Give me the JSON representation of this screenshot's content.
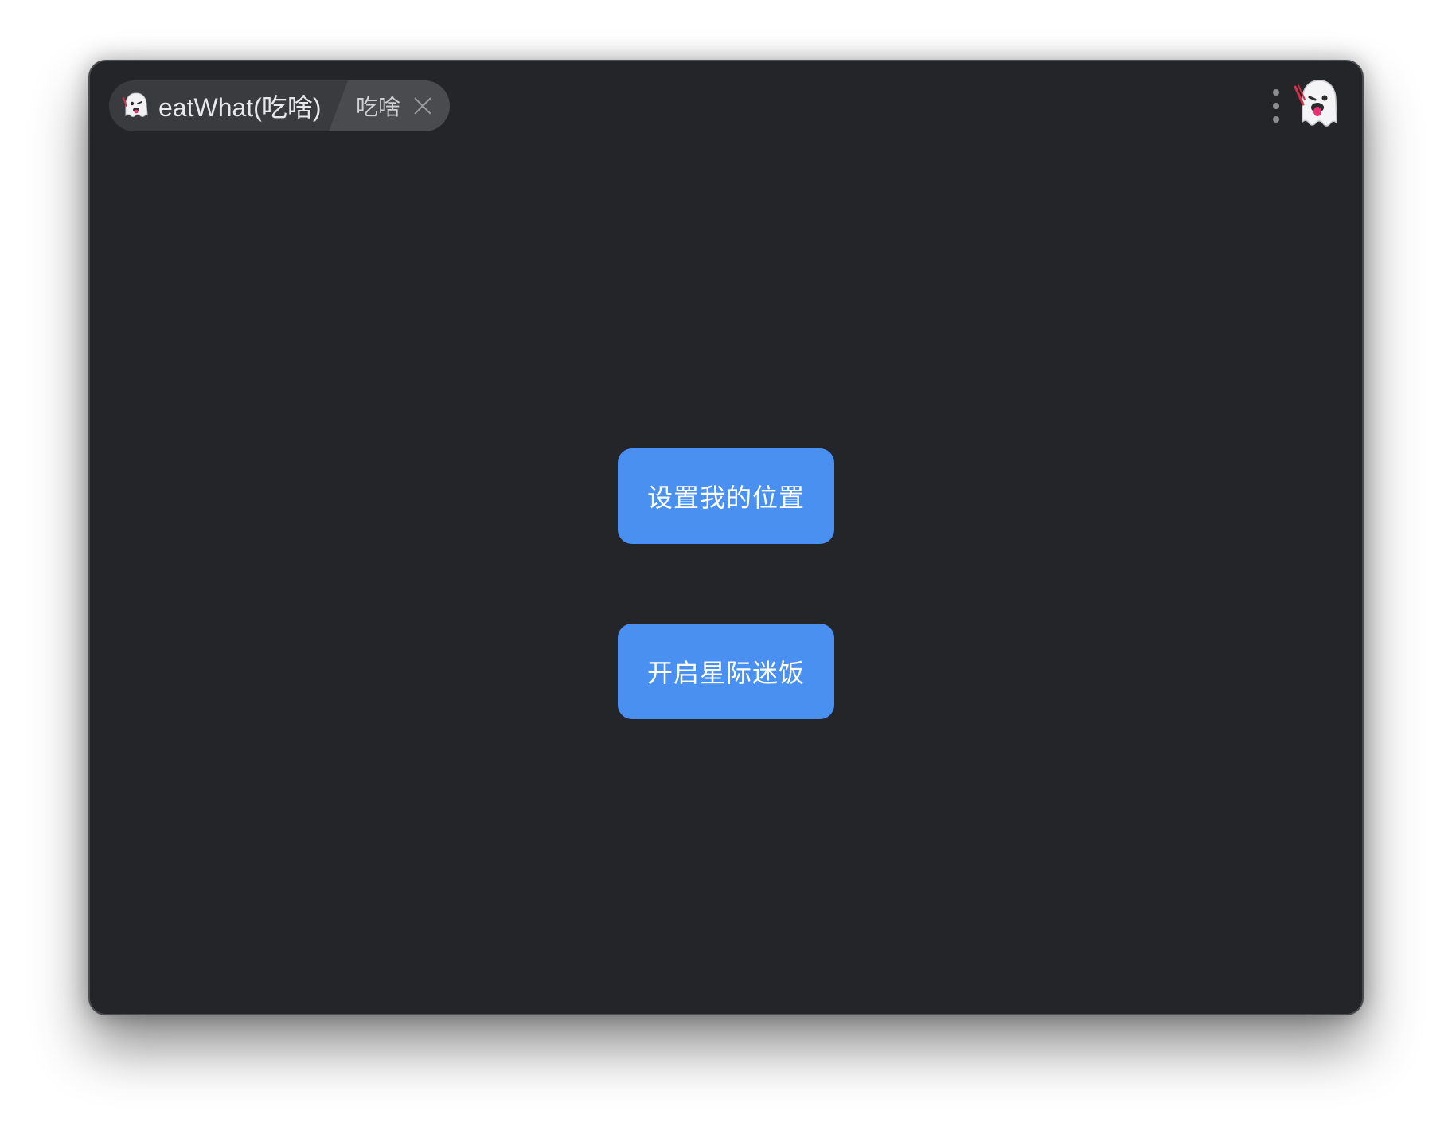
{
  "window": {
    "app_title": "eatWhat(吃啥)",
    "tab_label": "吃啥",
    "app_icon": "ghost-icon",
    "menu_icon": "vertical-dots-icon",
    "avatar_icon": "ghost-avatar-icon"
  },
  "main": {
    "set_location_label": "设置我的位置",
    "start_label": "开启星际迷饭"
  },
  "colors": {
    "window_bg": "#242528",
    "button_bg": "#4a90f0",
    "button_text": "#ffffff"
  }
}
